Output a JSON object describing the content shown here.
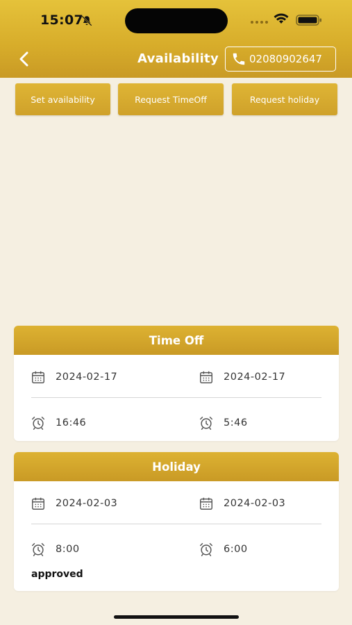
{
  "status_bar": {
    "time": "15:07"
  },
  "header": {
    "title": "Availability",
    "phone": "02080902647"
  },
  "tabs": [
    {
      "label": "Set availability"
    },
    {
      "label": "Request TimeOff"
    },
    {
      "label": "Request holiday"
    }
  ],
  "time_off": {
    "title": "Time Off",
    "start_date": "2024-02-17",
    "end_date": "2024-02-17",
    "start_time": "16:46",
    "end_time": "5:46"
  },
  "holiday": {
    "title": "Holiday",
    "start_date": "2024-02-03",
    "end_date": "2024-02-03",
    "start_time": "8:00",
    "end_time": "6:00",
    "status": "approved"
  },
  "colors": {
    "brand": "#d4a82b",
    "background": "#f5efe1"
  }
}
